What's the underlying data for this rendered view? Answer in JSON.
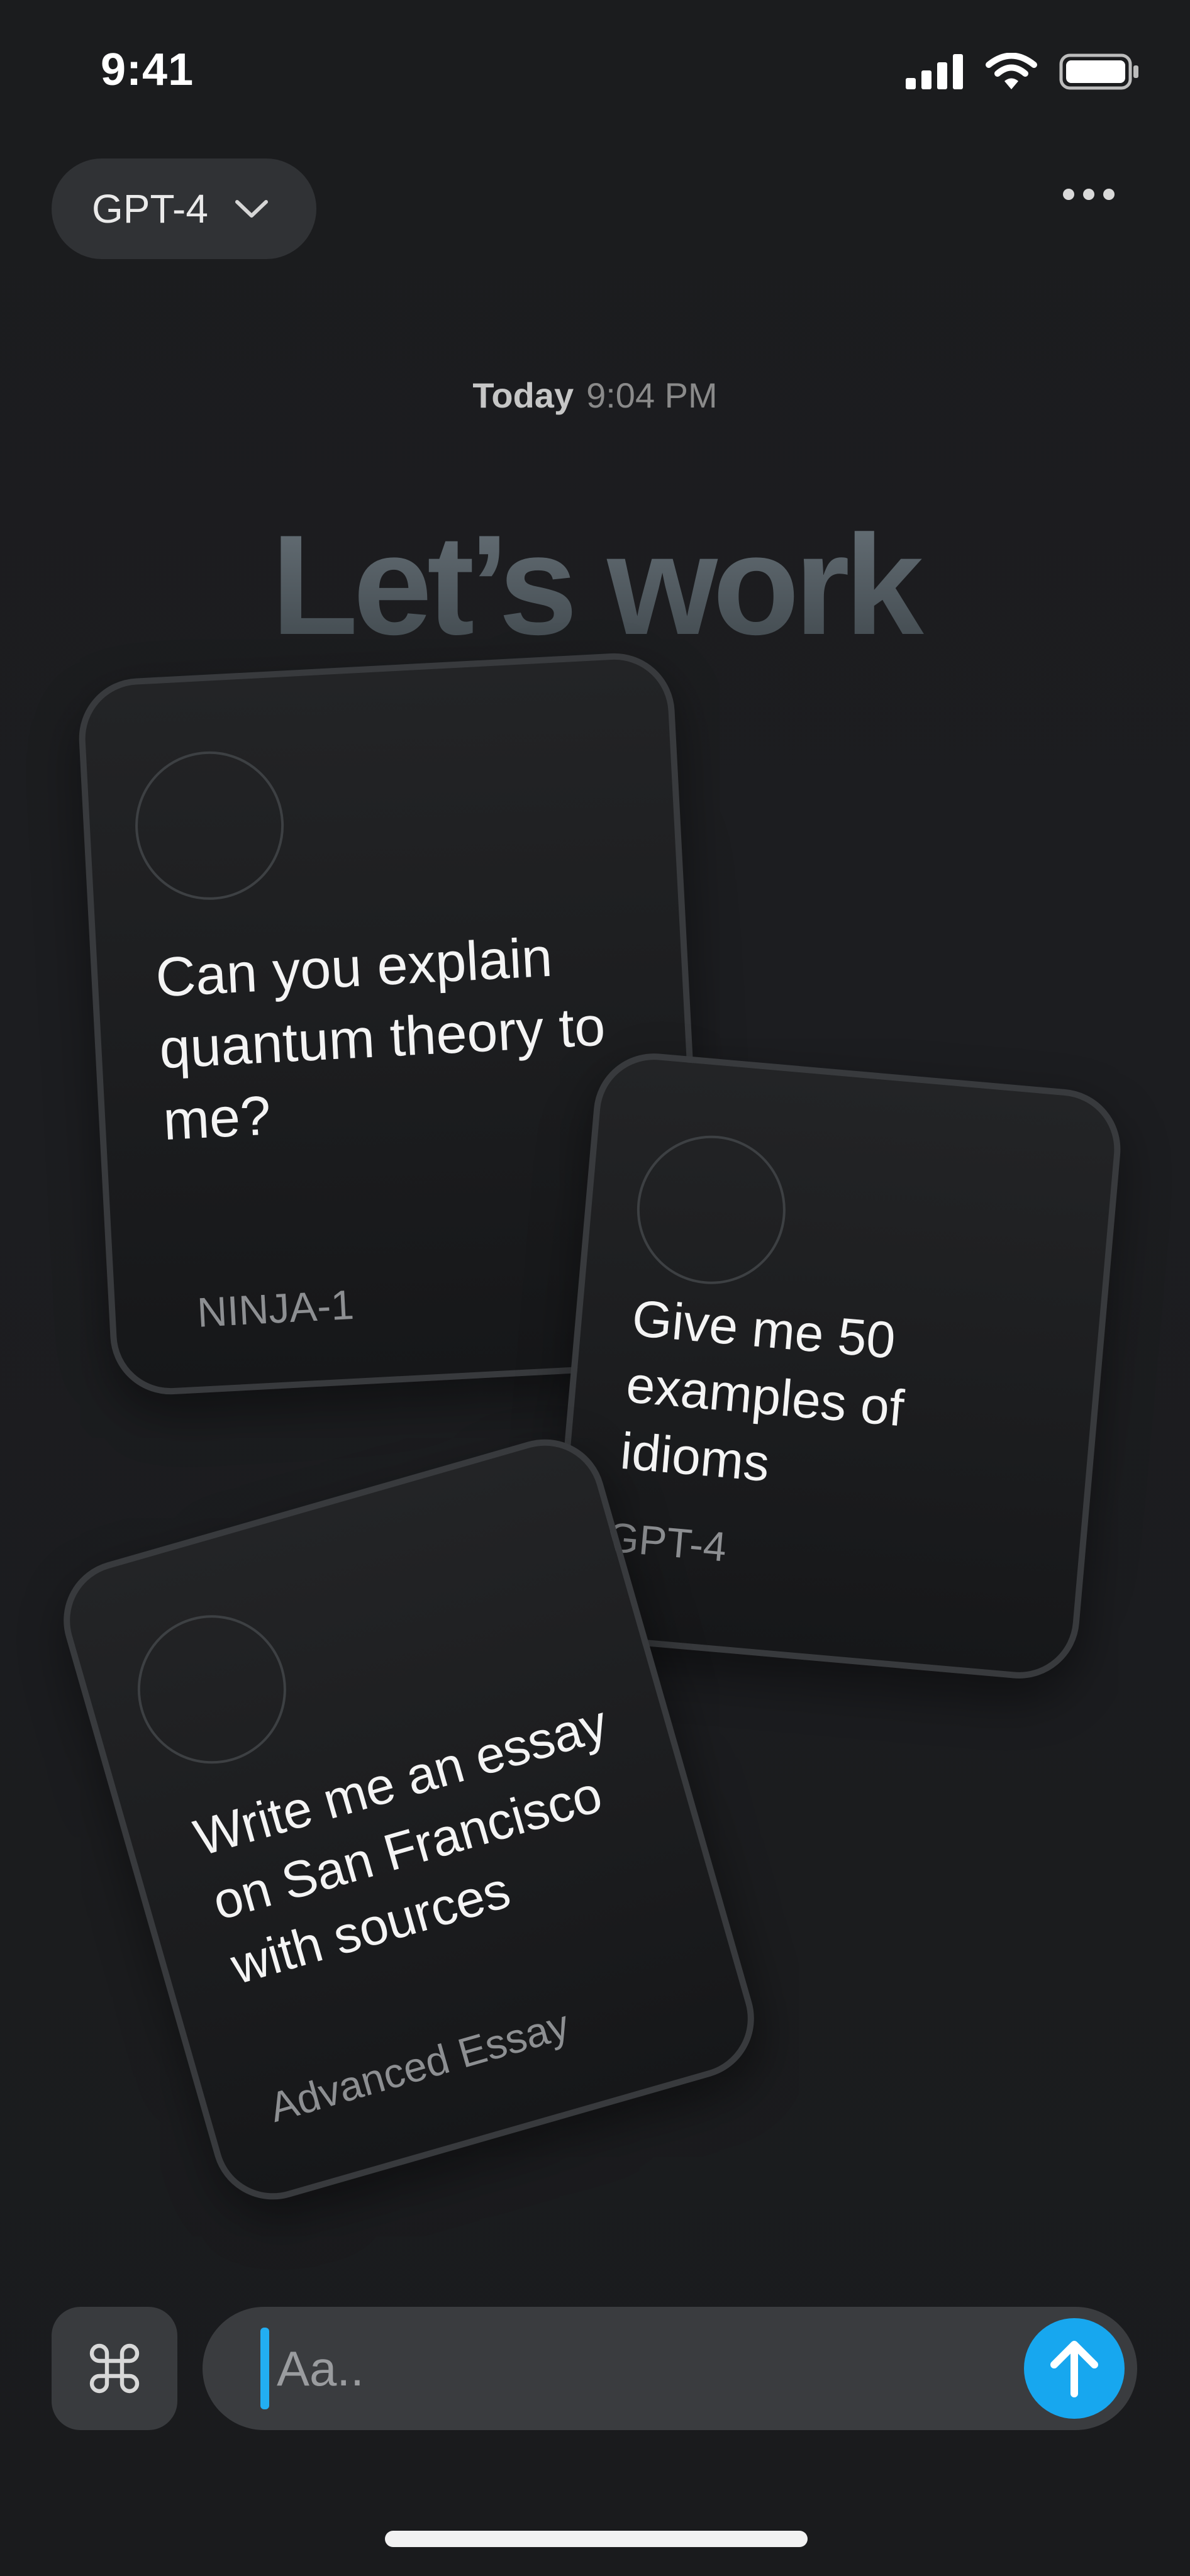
{
  "status_bar": {
    "time": "9:41",
    "icons": [
      "cellular-signal-icon",
      "wifi-icon",
      "battery-icon"
    ]
  },
  "top_bar": {
    "model": "GPT-4",
    "model_icon": "chevron-down-icon",
    "more_icon": "ellipsis-icon"
  },
  "timestamp": {
    "day": "Today",
    "time": "9:04 PM"
  },
  "headline": "Let’s work",
  "cards": [
    {
      "prompt": "Can you explain quantum theory to me?",
      "tag": "NINJA-1"
    },
    {
      "prompt": "Give me 50 examples of idioms",
      "tag": "GPT-4"
    },
    {
      "prompt": "Write me an essay on San Francisco with sources",
      "tag": "Advanced Essay"
    }
  ],
  "composer": {
    "placeholder": "Aa..",
    "value": "",
    "command_icon": "command-icon",
    "send_icon": "arrow-up-icon"
  },
  "colors": {
    "accent": "#17a7ef",
    "background": "#1b1c1e",
    "card_border": "#383a3d"
  }
}
